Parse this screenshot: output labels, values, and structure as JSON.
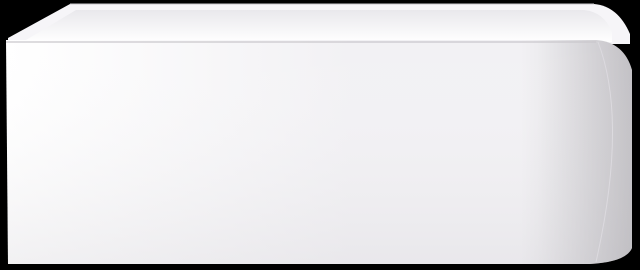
{
  "scene": {
    "subject": "bathtub-icon",
    "colors": {
      "background": "#000000",
      "panel_light": "#ffffff",
      "panel_mid": "#f2f1f4",
      "panel_shadow": "#dcdadf",
      "rim_top": "#f6f5f8",
      "basin_inner": "#e9e8ec",
      "rim_edge": "#c9c7cc"
    }
  }
}
